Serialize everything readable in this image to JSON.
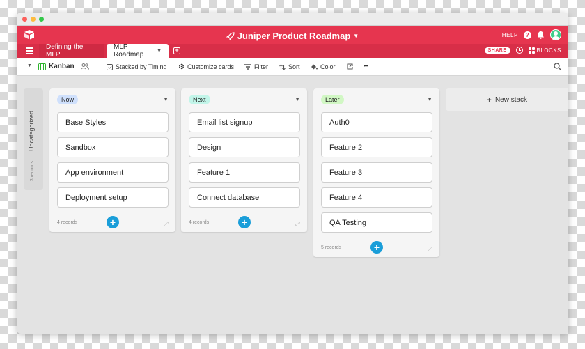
{
  "window": {
    "traffic_lights": [
      "#fc605c",
      "#fdbc40",
      "#34c84a"
    ]
  },
  "app": {
    "title": "Juniper Product Roadmap",
    "brand_color": "#e6354f",
    "help_label": "HELP",
    "help_icon": "question-circle-icon",
    "notification_icon": "bell-icon",
    "avatar_color": "#3fce8b"
  },
  "tabs": {
    "items": [
      {
        "label": "Defining the MLP",
        "active": false
      },
      {
        "label": "MLP Roadmap",
        "active": true
      }
    ],
    "share_label": "SHARE",
    "blocks_label": "BLOCKS"
  },
  "toolbar": {
    "view_name": "Kanban",
    "stacked_by": "Stacked by Timing",
    "customize": "Customize cards",
    "filter": "Filter",
    "sort": "Sort",
    "color": "Color",
    "more": "•••"
  },
  "board": {
    "uncategorized": {
      "label": "Uncategorized",
      "count": "3 records"
    },
    "stacks": [
      {
        "name": "Now",
        "pill_color": "#cfe0fc",
        "cards": [
          "Base Styles",
          "Sandbox",
          "App environment",
          "Deployment setup"
        ],
        "records": "4 records"
      },
      {
        "name": "Next",
        "pill_color": "#c2f5e9",
        "cards": [
          "Email list signup",
          "Design",
          "Feature 1",
          "Connect database"
        ],
        "records": "4 records"
      },
      {
        "name": "Later",
        "pill_color": "#d1f7c4",
        "cards": [
          "Auth0",
          "Feature 2",
          "Feature 3",
          "Feature 4",
          "QA Testing"
        ],
        "records": "5 records"
      }
    ],
    "new_stack_label": "New stack",
    "add_button_color": "#1a9ed9"
  }
}
